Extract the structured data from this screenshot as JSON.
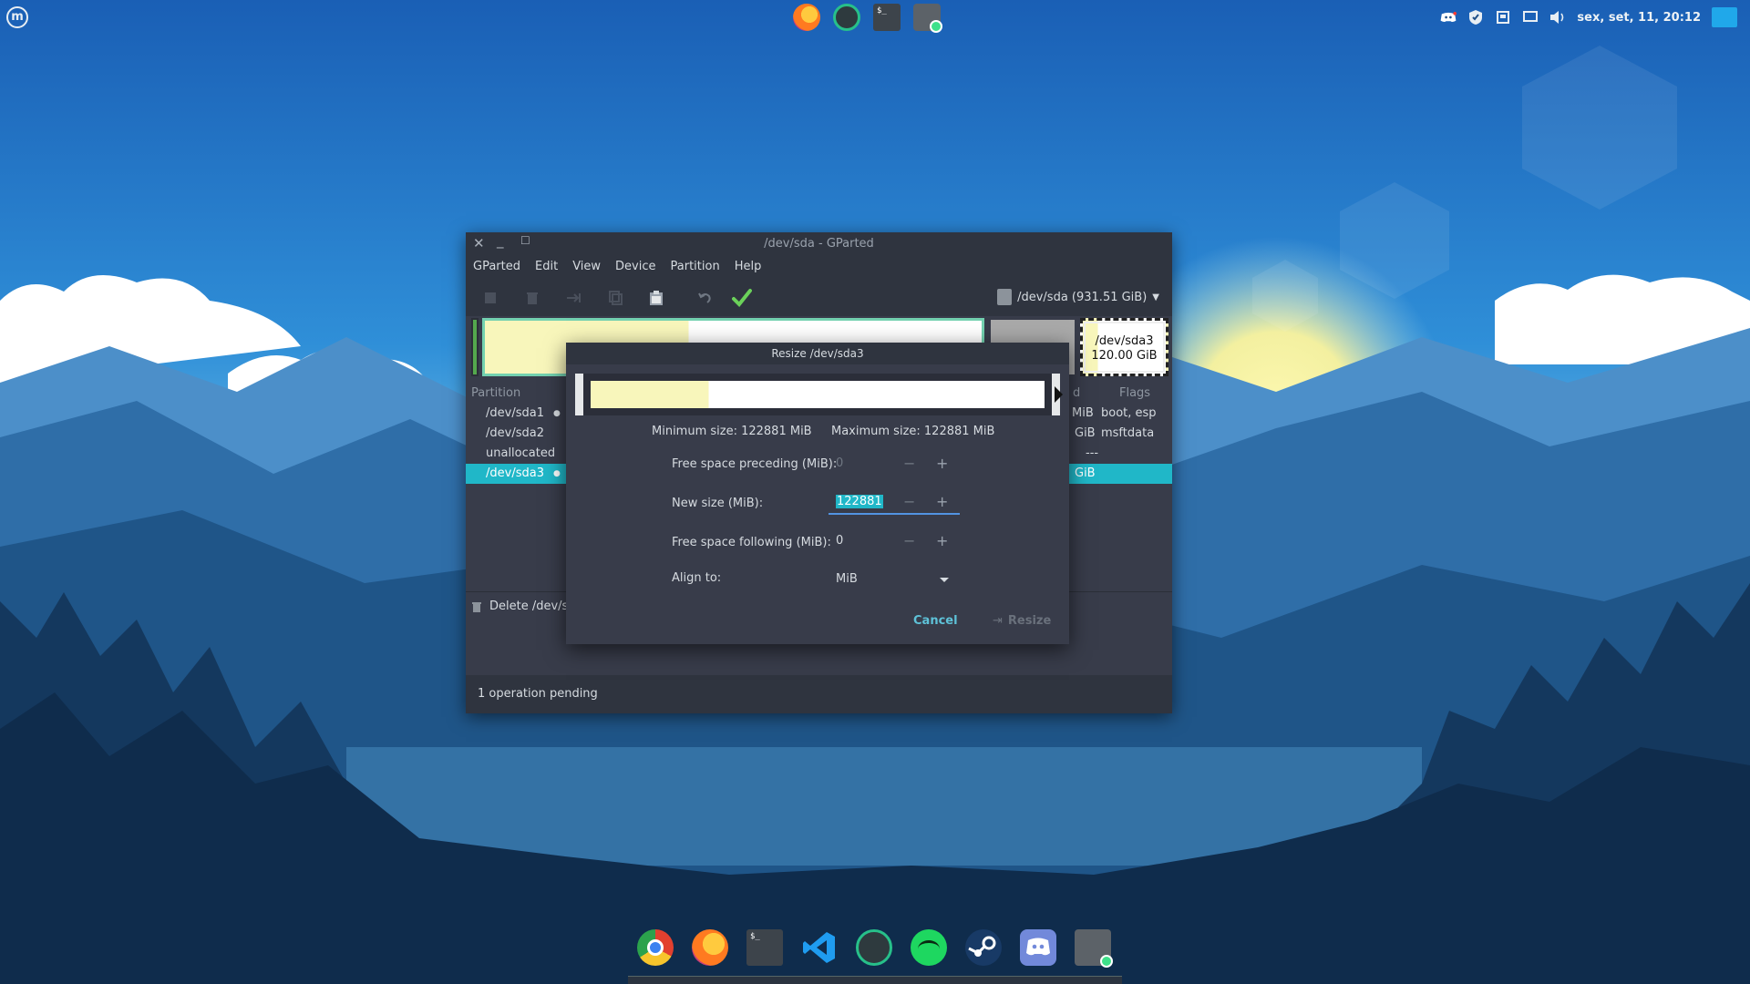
{
  "panel": {
    "clock": "sex, set, 11, 20:12",
    "top_launchers": [
      "firefox-icon",
      "android-studio-icon",
      "terminal-icon",
      "gparted-icon"
    ],
    "tray_icons": [
      "discord-icon",
      "shield-icon",
      "save-icon",
      "display-icon",
      "volume-icon"
    ]
  },
  "window": {
    "title": "/dev/sda - GParted",
    "menu": [
      "GParted",
      "Edit",
      "View",
      "Device",
      "Partition",
      "Help"
    ],
    "device_selector": "/dev/sda (931.51 GiB)",
    "diskmap": {
      "sda3_name": "/dev/sda3",
      "sda3_size": "120.00 GiB",
      "sda2_label_partial": "/dev/sda2"
    },
    "columns": {
      "partition": "Partition",
      "used_partial": "d",
      "flags": "Flags"
    },
    "partitions": [
      {
        "name": "/dev/sda1",
        "size_tail": "MiB",
        "flags": "boot, esp"
      },
      {
        "name": "/dev/sda2",
        "size_tail": "GiB",
        "flags": "msftdata"
      },
      {
        "name": "unallocated",
        "size_tail": "",
        "flags": "---"
      },
      {
        "name": "/dev/sda3",
        "size_tail": "GiB",
        "flags": ""
      }
    ],
    "pending_op": "Delete /dev/sc",
    "status": "1 operation pending"
  },
  "dialog": {
    "title": "Resize /dev/sda3",
    "min_size": "Minimum size: 122881 MiB",
    "max_size": "Maximum size: 122881 MiB",
    "free_preceding_label": "Free space preceding (MiB):",
    "free_preceding_value": "0",
    "new_size_label": "New size (MiB):",
    "new_size_value": "122881",
    "free_following_label": "Free space following (MiB):",
    "free_following_value": "0",
    "align_label": "Align to:",
    "align_value": "MiB",
    "cancel_label": "Cancel",
    "resize_label": "Resize"
  },
  "colors": {
    "selection": "#20b7c8",
    "accent_link": "#5ec2d8",
    "partition_used": "#f8f6bb",
    "partition_border": "#73d1b0"
  }
}
